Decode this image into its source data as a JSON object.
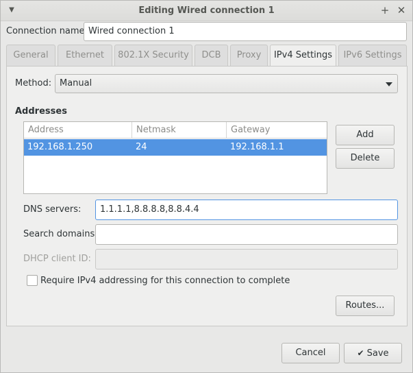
{
  "window": {
    "title": "Editing Wired connection 1",
    "menu_icon": "chevron-down-icon",
    "maximize_icon": "plus-icon",
    "close_icon": "close-icon"
  },
  "connection_name": {
    "label": "Connection name:",
    "value": "Wired connection 1"
  },
  "tabs": [
    {
      "label": "General",
      "active": false
    },
    {
      "label": "Ethernet",
      "active": false
    },
    {
      "label": "802.1X Security",
      "active": false
    },
    {
      "label": "DCB",
      "active": false
    },
    {
      "label": "Proxy",
      "active": false
    },
    {
      "label": "IPv4 Settings",
      "active": true
    },
    {
      "label": "IPv6 Settings",
      "active": false
    }
  ],
  "ipv4": {
    "method_label": "Method:",
    "method_value": "Manual",
    "addresses_title": "Addresses",
    "columns": [
      "Address",
      "Netmask",
      "Gateway"
    ],
    "rows": [
      {
        "address": "192.168.1.250",
        "netmask": "24",
        "gateway": "192.168.1.1",
        "selected": true
      }
    ],
    "add_label": "Add",
    "delete_label": "Delete",
    "dns_label": "DNS servers:",
    "dns_value": "1.1.1.1,8.8.8.8,8.8.4.4",
    "search_label": "Search domains:",
    "search_value": "",
    "dhcp_label": "DHCP client ID:",
    "dhcp_value": "",
    "require_label": "Require IPv4 addressing for this connection to complete",
    "require_checked": false,
    "routes_label": "Routes..."
  },
  "footer": {
    "cancel_label": "Cancel",
    "save_label": "Save",
    "save_icon": "checkmark-icon"
  },
  "colors": {
    "accent": "#5294e2",
    "background": "#e8e8e7"
  }
}
